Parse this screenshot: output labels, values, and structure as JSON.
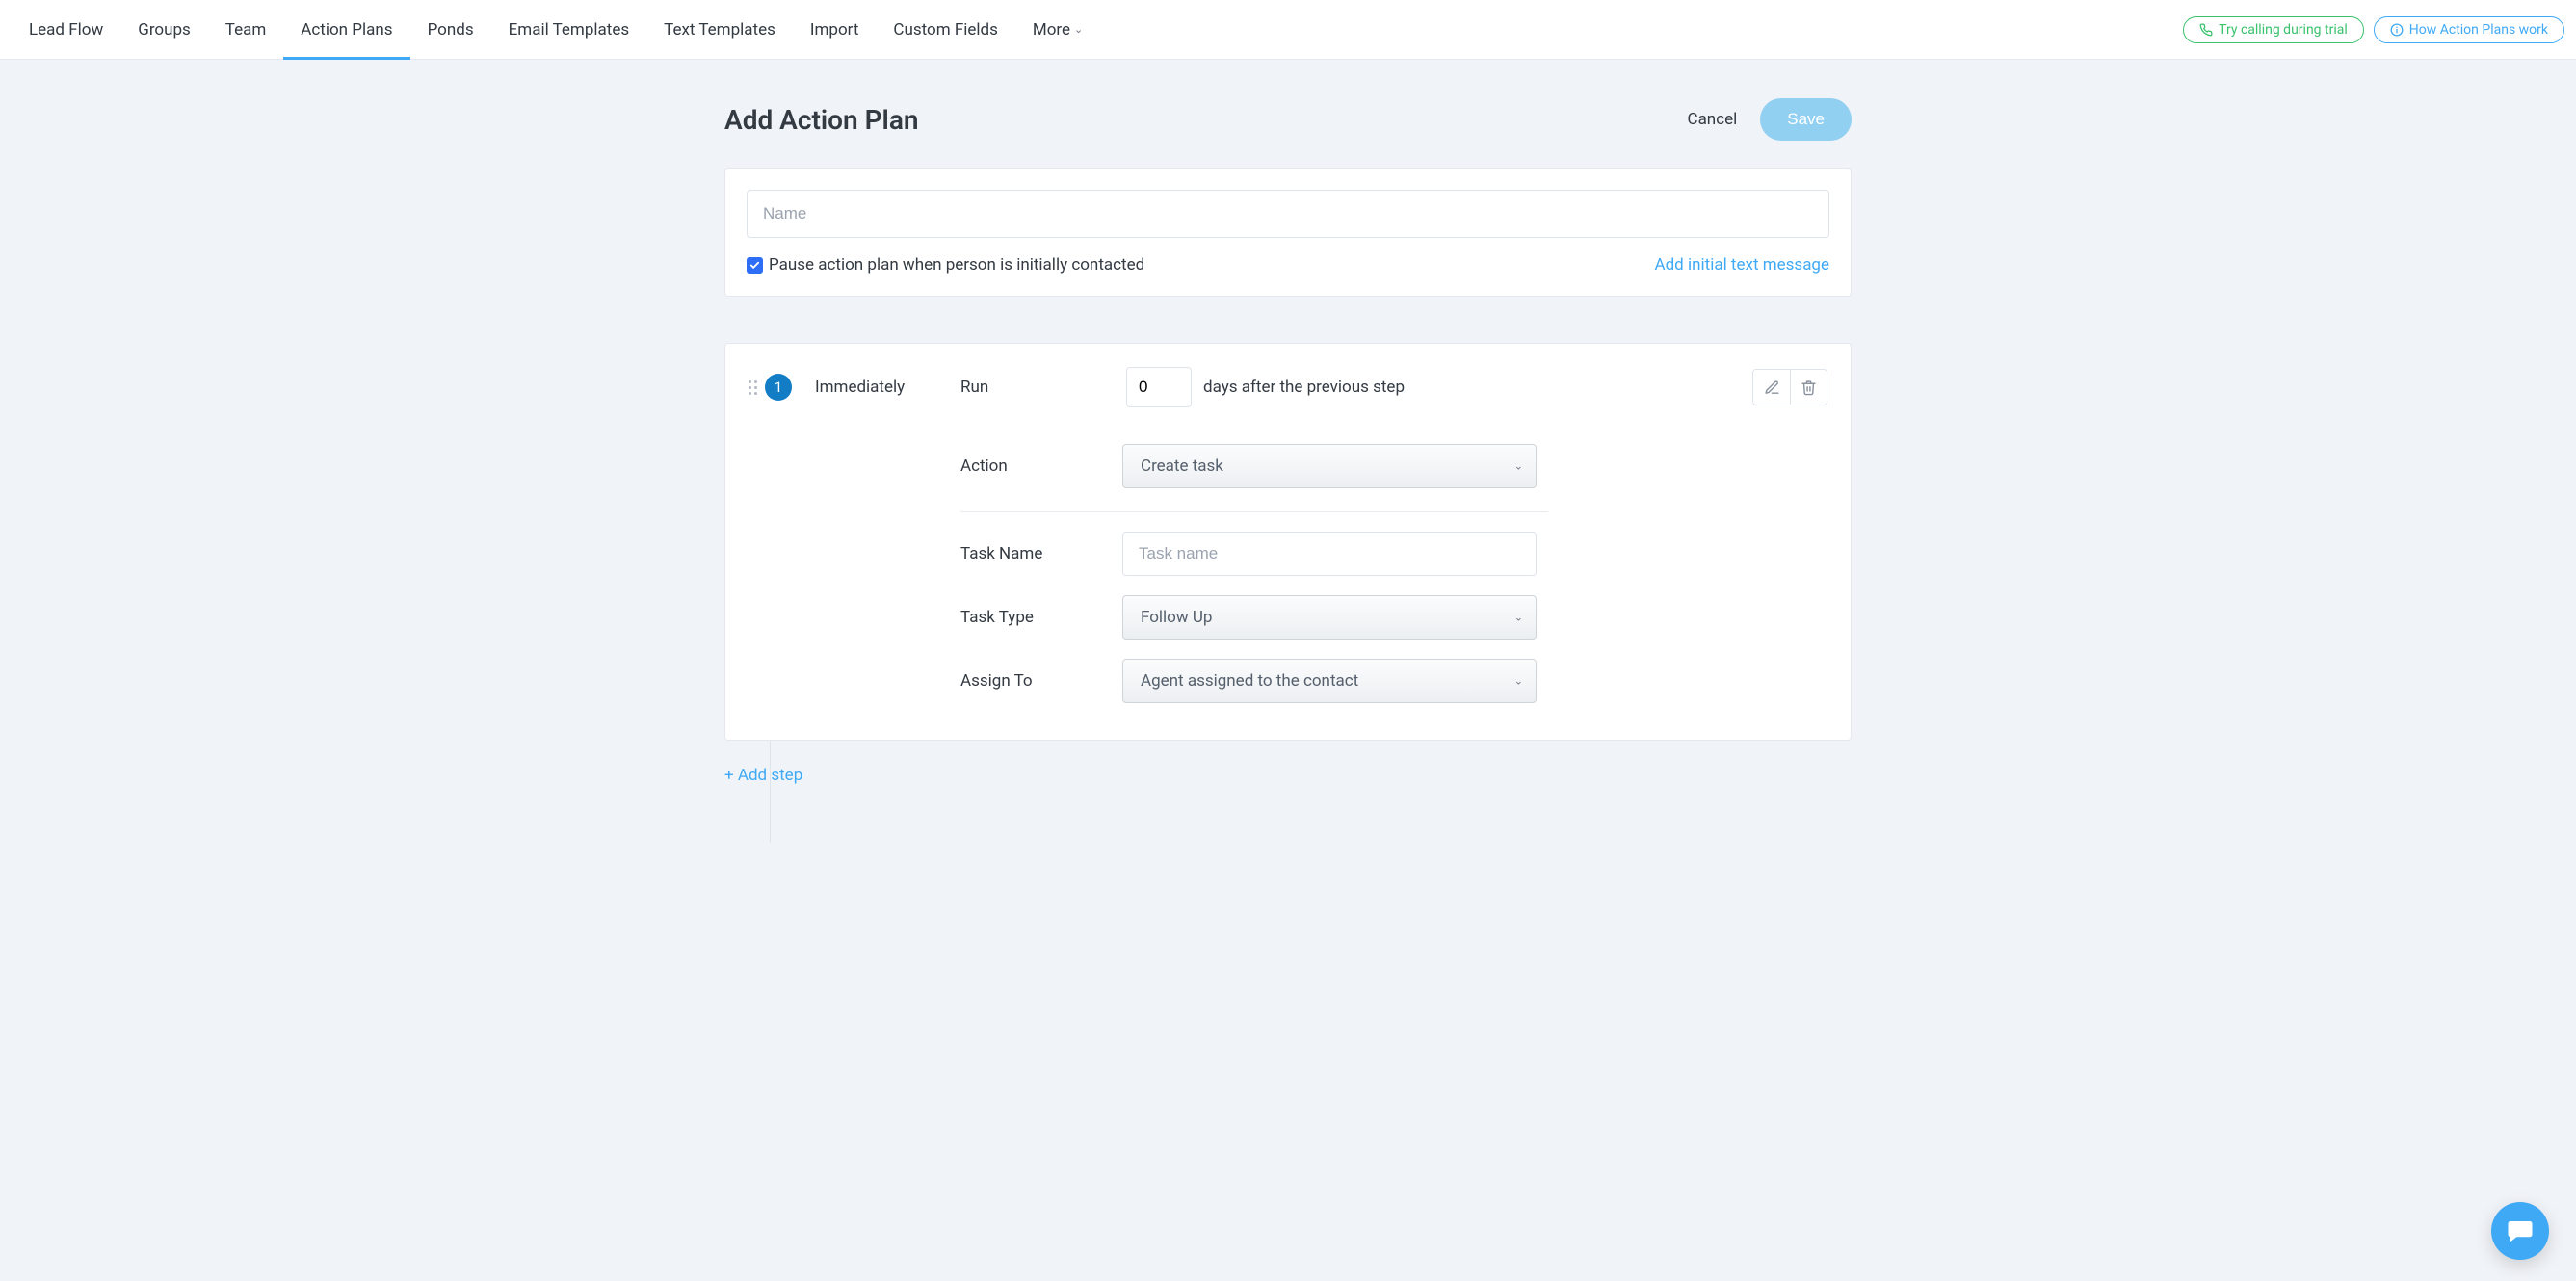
{
  "nav": {
    "items": [
      "Lead Flow",
      "Groups",
      "Team",
      "Action Plans",
      "Ponds",
      "Email Templates",
      "Text Templates",
      "Import",
      "Custom Fields"
    ],
    "more_label": "More",
    "active_index": 3
  },
  "header_buttons": {
    "trial_call": "Try calling during trial",
    "how_plans": "How Action Plans work"
  },
  "page": {
    "title": "Add Action Plan",
    "cancel": "Cancel",
    "save": "Save"
  },
  "plan_form": {
    "name_placeholder": "Name",
    "pause_label": "Pause action plan when person is initially contacted",
    "pause_checked": true,
    "add_initial_text": "Add initial text message"
  },
  "step": {
    "number": "1",
    "timing_label": "Immediately",
    "run_label": "Run",
    "days_value": "0",
    "after_label": "days after the previous step",
    "action_label": "Action",
    "action_value": "Create task",
    "task_name_label": "Task Name",
    "task_name_placeholder": "Task name",
    "task_type_label": "Task Type",
    "task_type_value": "Follow Up",
    "assign_label": "Assign To",
    "assign_value": "Agent assigned to the contact"
  },
  "add_step": "+ Add step"
}
